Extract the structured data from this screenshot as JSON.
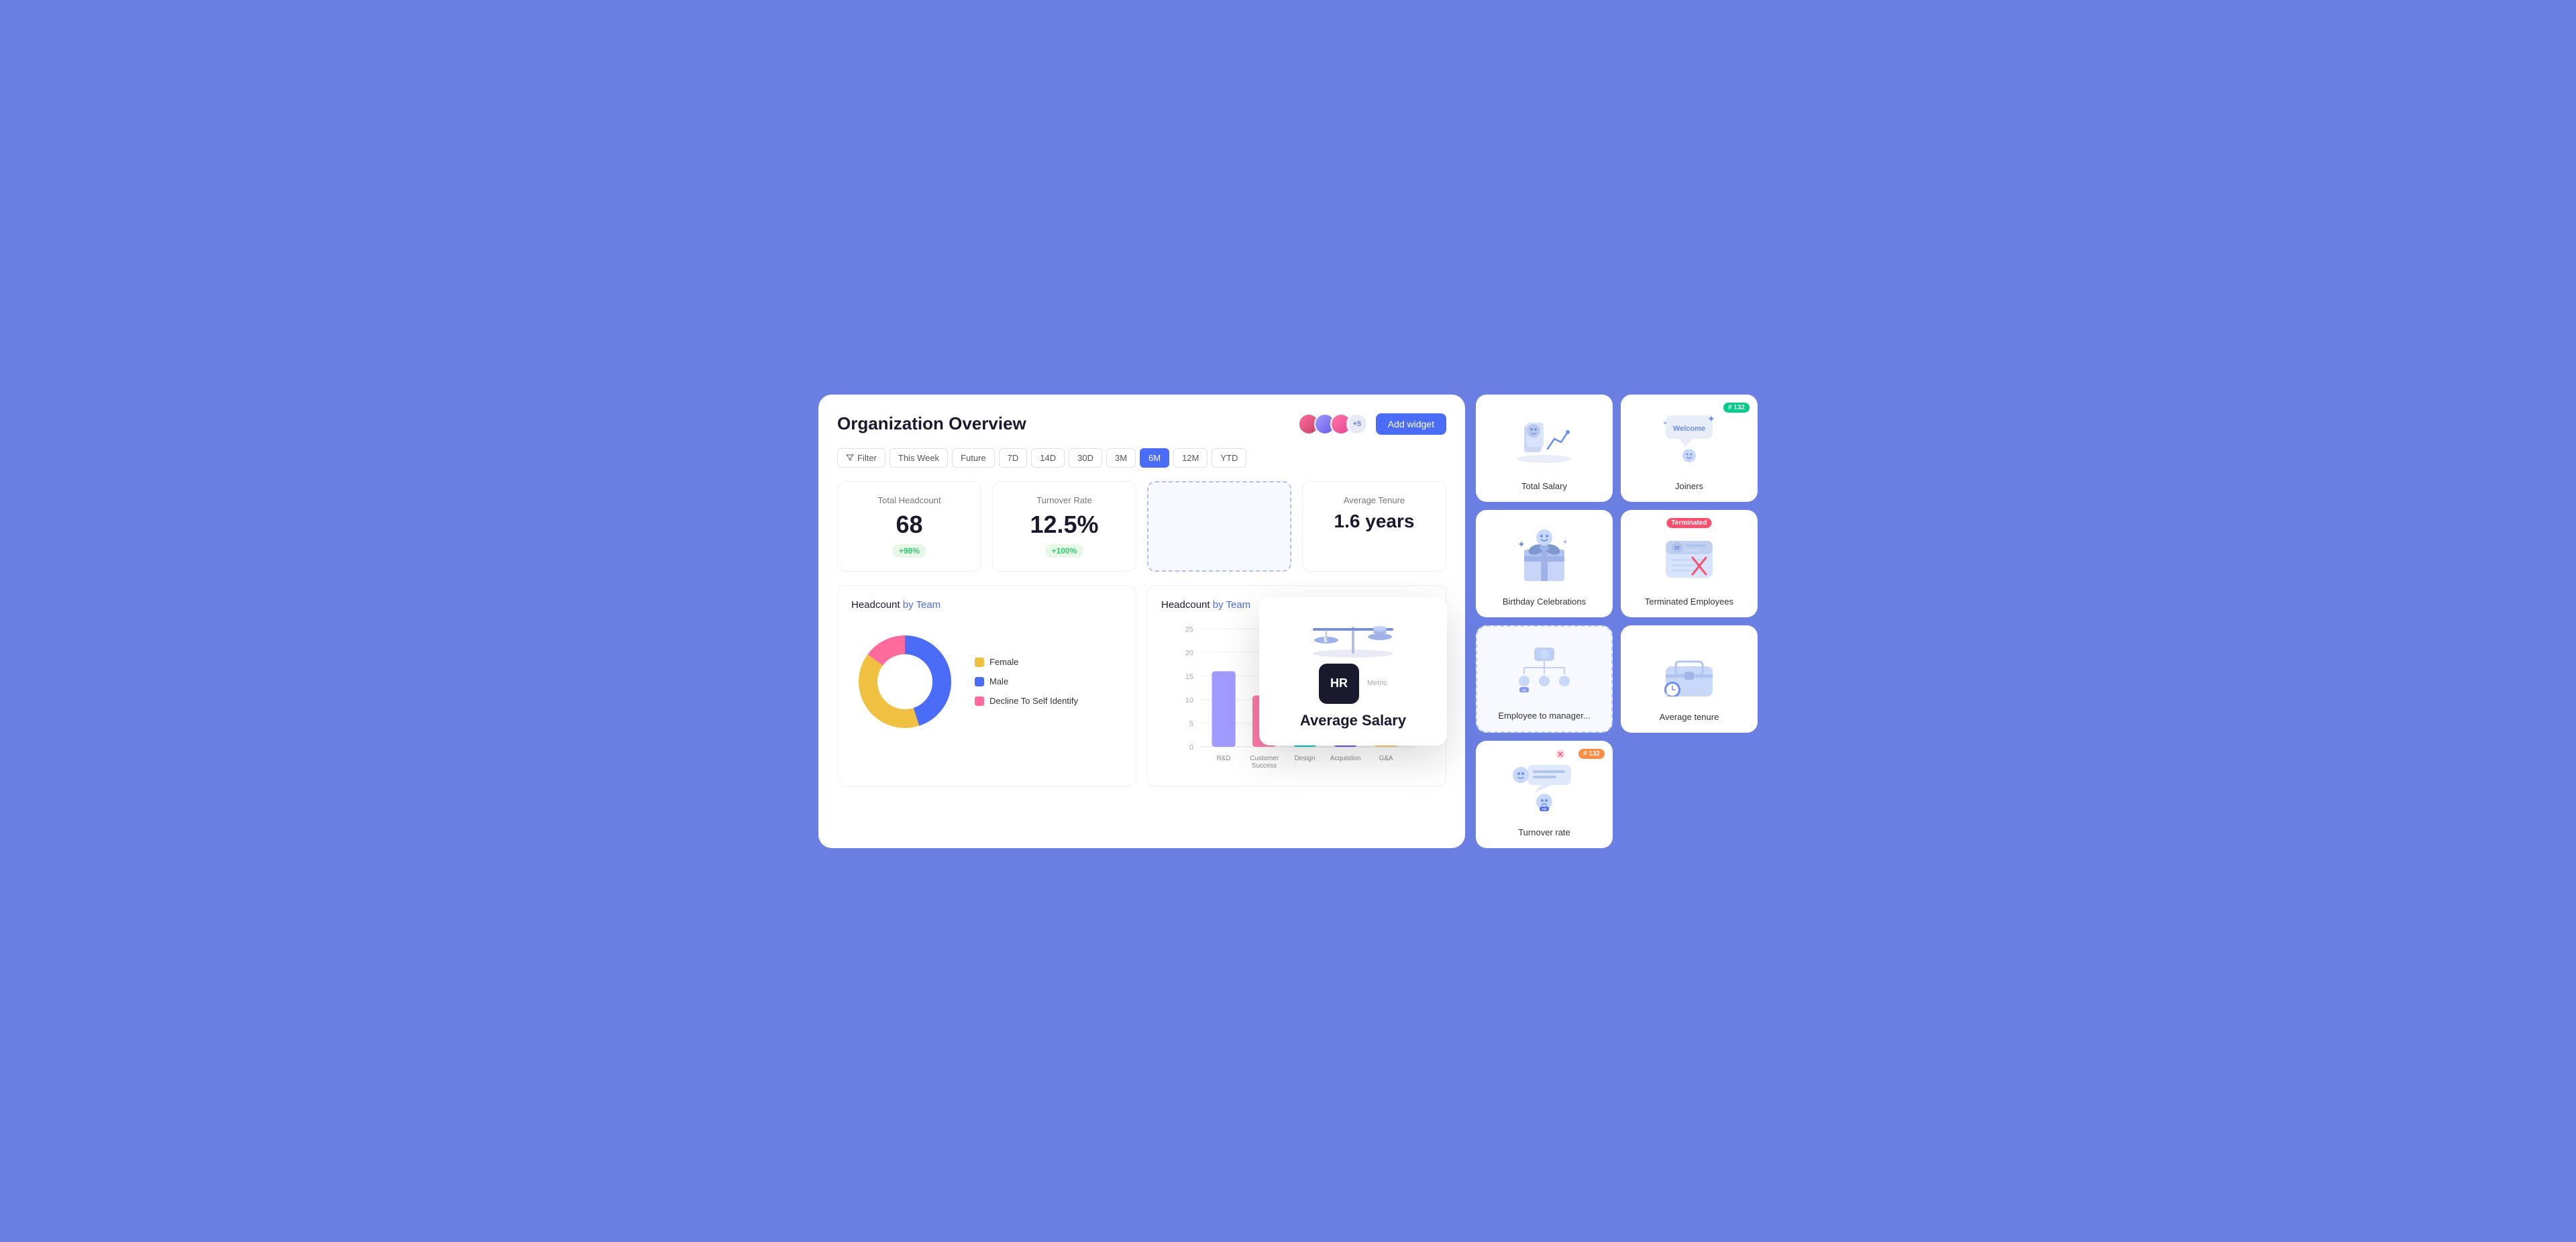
{
  "page": {
    "background_color": "#6b7fe3"
  },
  "left_panel": {
    "title": "Organization Overview",
    "add_widget_label": "Add widget",
    "avatar_extra": "+5",
    "filter_label": "Filter",
    "time_filters": [
      "This Week",
      "Future",
      "7D",
      "14D",
      "30D",
      "3M",
      "6M",
      "12M",
      "YTD"
    ],
    "active_filter": "6M",
    "metrics": [
      {
        "label": "Total Headcount",
        "value": "68",
        "badge": "+98%"
      },
      {
        "label": "Turnover Rate",
        "value": "12.5%",
        "badge": "+100%"
      },
      {
        "label": "",
        "value": "",
        "badge": "",
        "dashed": true
      },
      {
        "label": "Average Tenure",
        "value": "1.6 years",
        "badge": ""
      }
    ],
    "headcount_by_team_left": {
      "title": "Headcount",
      "title_accent": "by Team",
      "legend": [
        {
          "label": "Female",
          "color": "#f0c040"
        },
        {
          "label": "Male",
          "color": "#4a6cf7"
        },
        {
          "label": "Decline To Self Identify",
          "color": "#ff6b9d"
        }
      ],
      "donut_segments": [
        {
          "color": "#f0c040",
          "percent": 40
        },
        {
          "color": "#4a6cf7",
          "percent": 45
        },
        {
          "color": "#ff6b9d",
          "percent": 15
        }
      ]
    },
    "headcount_by_team_right": {
      "title": "Headcount",
      "title_accent": "by Team",
      "bars": [
        {
          "label": "R&D",
          "value": 16,
          "color": "#a29bfe"
        },
        {
          "label": "Customer Success",
          "value": 11,
          "color": "#fd79a8"
        },
        {
          "label": "Design",
          "value": 18,
          "color": "#00cec9"
        },
        {
          "label": "Acquistion",
          "value": 14,
          "color": "#6c5ce7"
        },
        {
          "label": "G&A",
          "value": 20,
          "color": "#fdcb6e"
        }
      ],
      "y_axis": [
        0,
        5,
        10,
        15,
        20,
        25
      ],
      "max_value": 25
    }
  },
  "floating_card": {
    "hr_label": "HR",
    "card_label": "Average Salary"
  },
  "right_panel": {
    "widgets": [
      {
        "id": "total-salary",
        "label": "Total Salary",
        "badge": null,
        "badge_color": null
      },
      {
        "id": "joiners",
        "label": "Joiners",
        "badge": "#132",
        "badge_color": "green"
      },
      {
        "id": "birthday-celebrations",
        "label": "Birthday Celebrations",
        "badge": null,
        "badge_color": null
      },
      {
        "id": "terminated-employees",
        "label": "Terminated Employees",
        "badge": "Terminated",
        "badge_color": "red"
      },
      {
        "id": "employee-to-manager",
        "label": "Employee to manager...",
        "badge": null,
        "badge_color": null,
        "dashed": true
      },
      {
        "id": "average-tenure",
        "label": "Average tenure",
        "badge": null,
        "badge_color": null
      },
      {
        "id": "turnover-rate",
        "label": "Turnover rate",
        "badge": "#132",
        "badge_color": "orange"
      }
    ]
  }
}
